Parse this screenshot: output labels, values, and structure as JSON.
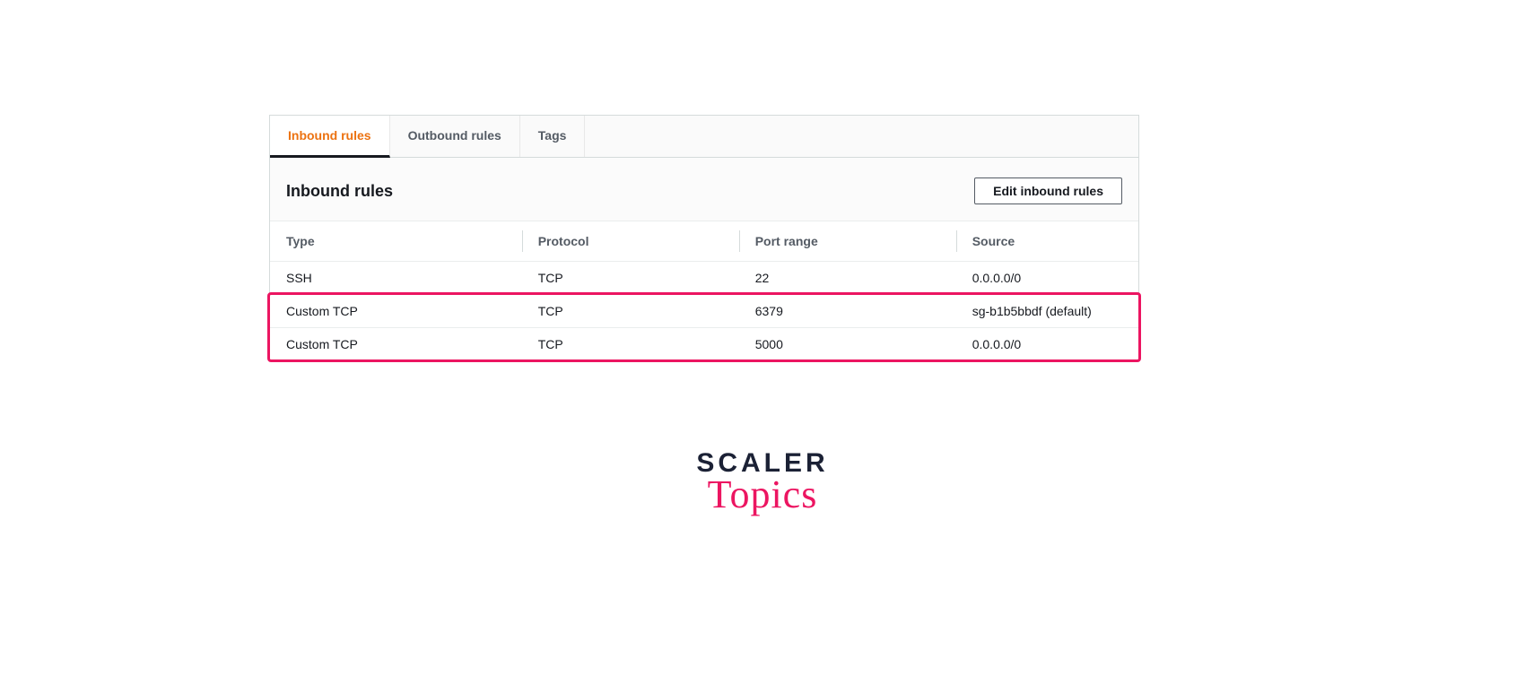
{
  "tabs": [
    {
      "label": "Inbound rules",
      "active": true
    },
    {
      "label": "Outbound rules",
      "active": false
    },
    {
      "label": "Tags",
      "active": false
    }
  ],
  "panel": {
    "title": "Inbound rules",
    "edit_label": "Edit inbound rules"
  },
  "columns": [
    "Type",
    "Protocol",
    "Port range",
    "Source"
  ],
  "rows": [
    {
      "type": "SSH",
      "protocol": "TCP",
      "port": "22",
      "source": "0.0.0.0/0",
      "highlighted": false
    },
    {
      "type": "Custom TCP",
      "protocol": "TCP",
      "port": "6379",
      "source": "sg-b1b5bbdf (default)",
      "highlighted": true
    },
    {
      "type": "Custom TCP",
      "protocol": "TCP",
      "port": "5000",
      "source": "0.0.0.0/0",
      "highlighted": true
    }
  ],
  "brand": {
    "main": "SCALER",
    "sub": "Topics"
  }
}
